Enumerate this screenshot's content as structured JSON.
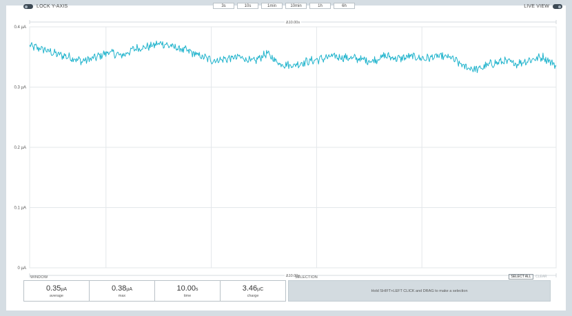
{
  "controls": {
    "lock_y_axis_label": "LOCK Y-AXIS",
    "live_view_label": "LIVE VIEW",
    "range_buttons": [
      "3s",
      "10s",
      "1min",
      "10min",
      "1h",
      "6h"
    ]
  },
  "chart_data": {
    "type": "line",
    "xlabel": "",
    "ylabel": "",
    "ylim": [
      0,
      0.4
    ],
    "y_ticks": [
      "0 µA",
      "0.1 µA",
      "0.2 µA",
      "0.3 µA",
      "0.4 µA"
    ],
    "x_span_label_top": "Δ10.00s",
    "x_span_label_bottom": "Δ10.00s",
    "x_range_s": [
      0,
      10
    ],
    "grid": true,
    "series": [
      {
        "color": "#1fb3cc",
        "x": [
          0.0,
          0.25,
          0.5,
          0.75,
          1.0,
          1.25,
          1.5,
          1.75,
          2.0,
          2.25,
          2.5,
          2.75,
          3.0,
          3.25,
          3.5,
          3.75,
          4.0,
          4.25,
          4.5,
          4.75,
          5.0,
          5.25,
          5.5,
          5.75,
          6.0,
          6.25,
          6.5,
          6.75,
          7.0,
          7.25,
          7.5,
          7.75,
          8.0,
          8.25,
          8.5,
          8.75,
          9.0,
          9.25,
          9.5,
          9.75,
          10.0
        ],
        "values": [
          0.368,
          0.363,
          0.355,
          0.35,
          0.343,
          0.349,
          0.358,
          0.352,
          0.364,
          0.367,
          0.373,
          0.366,
          0.36,
          0.351,
          0.344,
          0.347,
          0.35,
          0.342,
          0.356,
          0.339,
          0.336,
          0.342,
          0.346,
          0.351,
          0.349,
          0.347,
          0.343,
          0.352,
          0.347,
          0.351,
          0.347,
          0.351,
          0.349,
          0.334,
          0.329,
          0.338,
          0.343,
          0.339,
          0.345,
          0.35,
          0.336
        ]
      }
    ]
  },
  "window": {
    "label": "WINDOW",
    "stats": [
      {
        "value": "0.35",
        "unit": "µA",
        "caption": "average"
      },
      {
        "value": "0.38",
        "unit": "µA",
        "caption": "max"
      },
      {
        "value": "10.00",
        "unit": "s",
        "caption": "time"
      },
      {
        "value": "3.46",
        "unit": "µC",
        "caption": "charge"
      }
    ]
  },
  "selection": {
    "label": "SELECTION",
    "select_all_label": "SELECT ALL",
    "clear_label": "CLEAR",
    "hint": "Hold SHIFT+LEFT CLICK and DRAG to make a selection"
  }
}
